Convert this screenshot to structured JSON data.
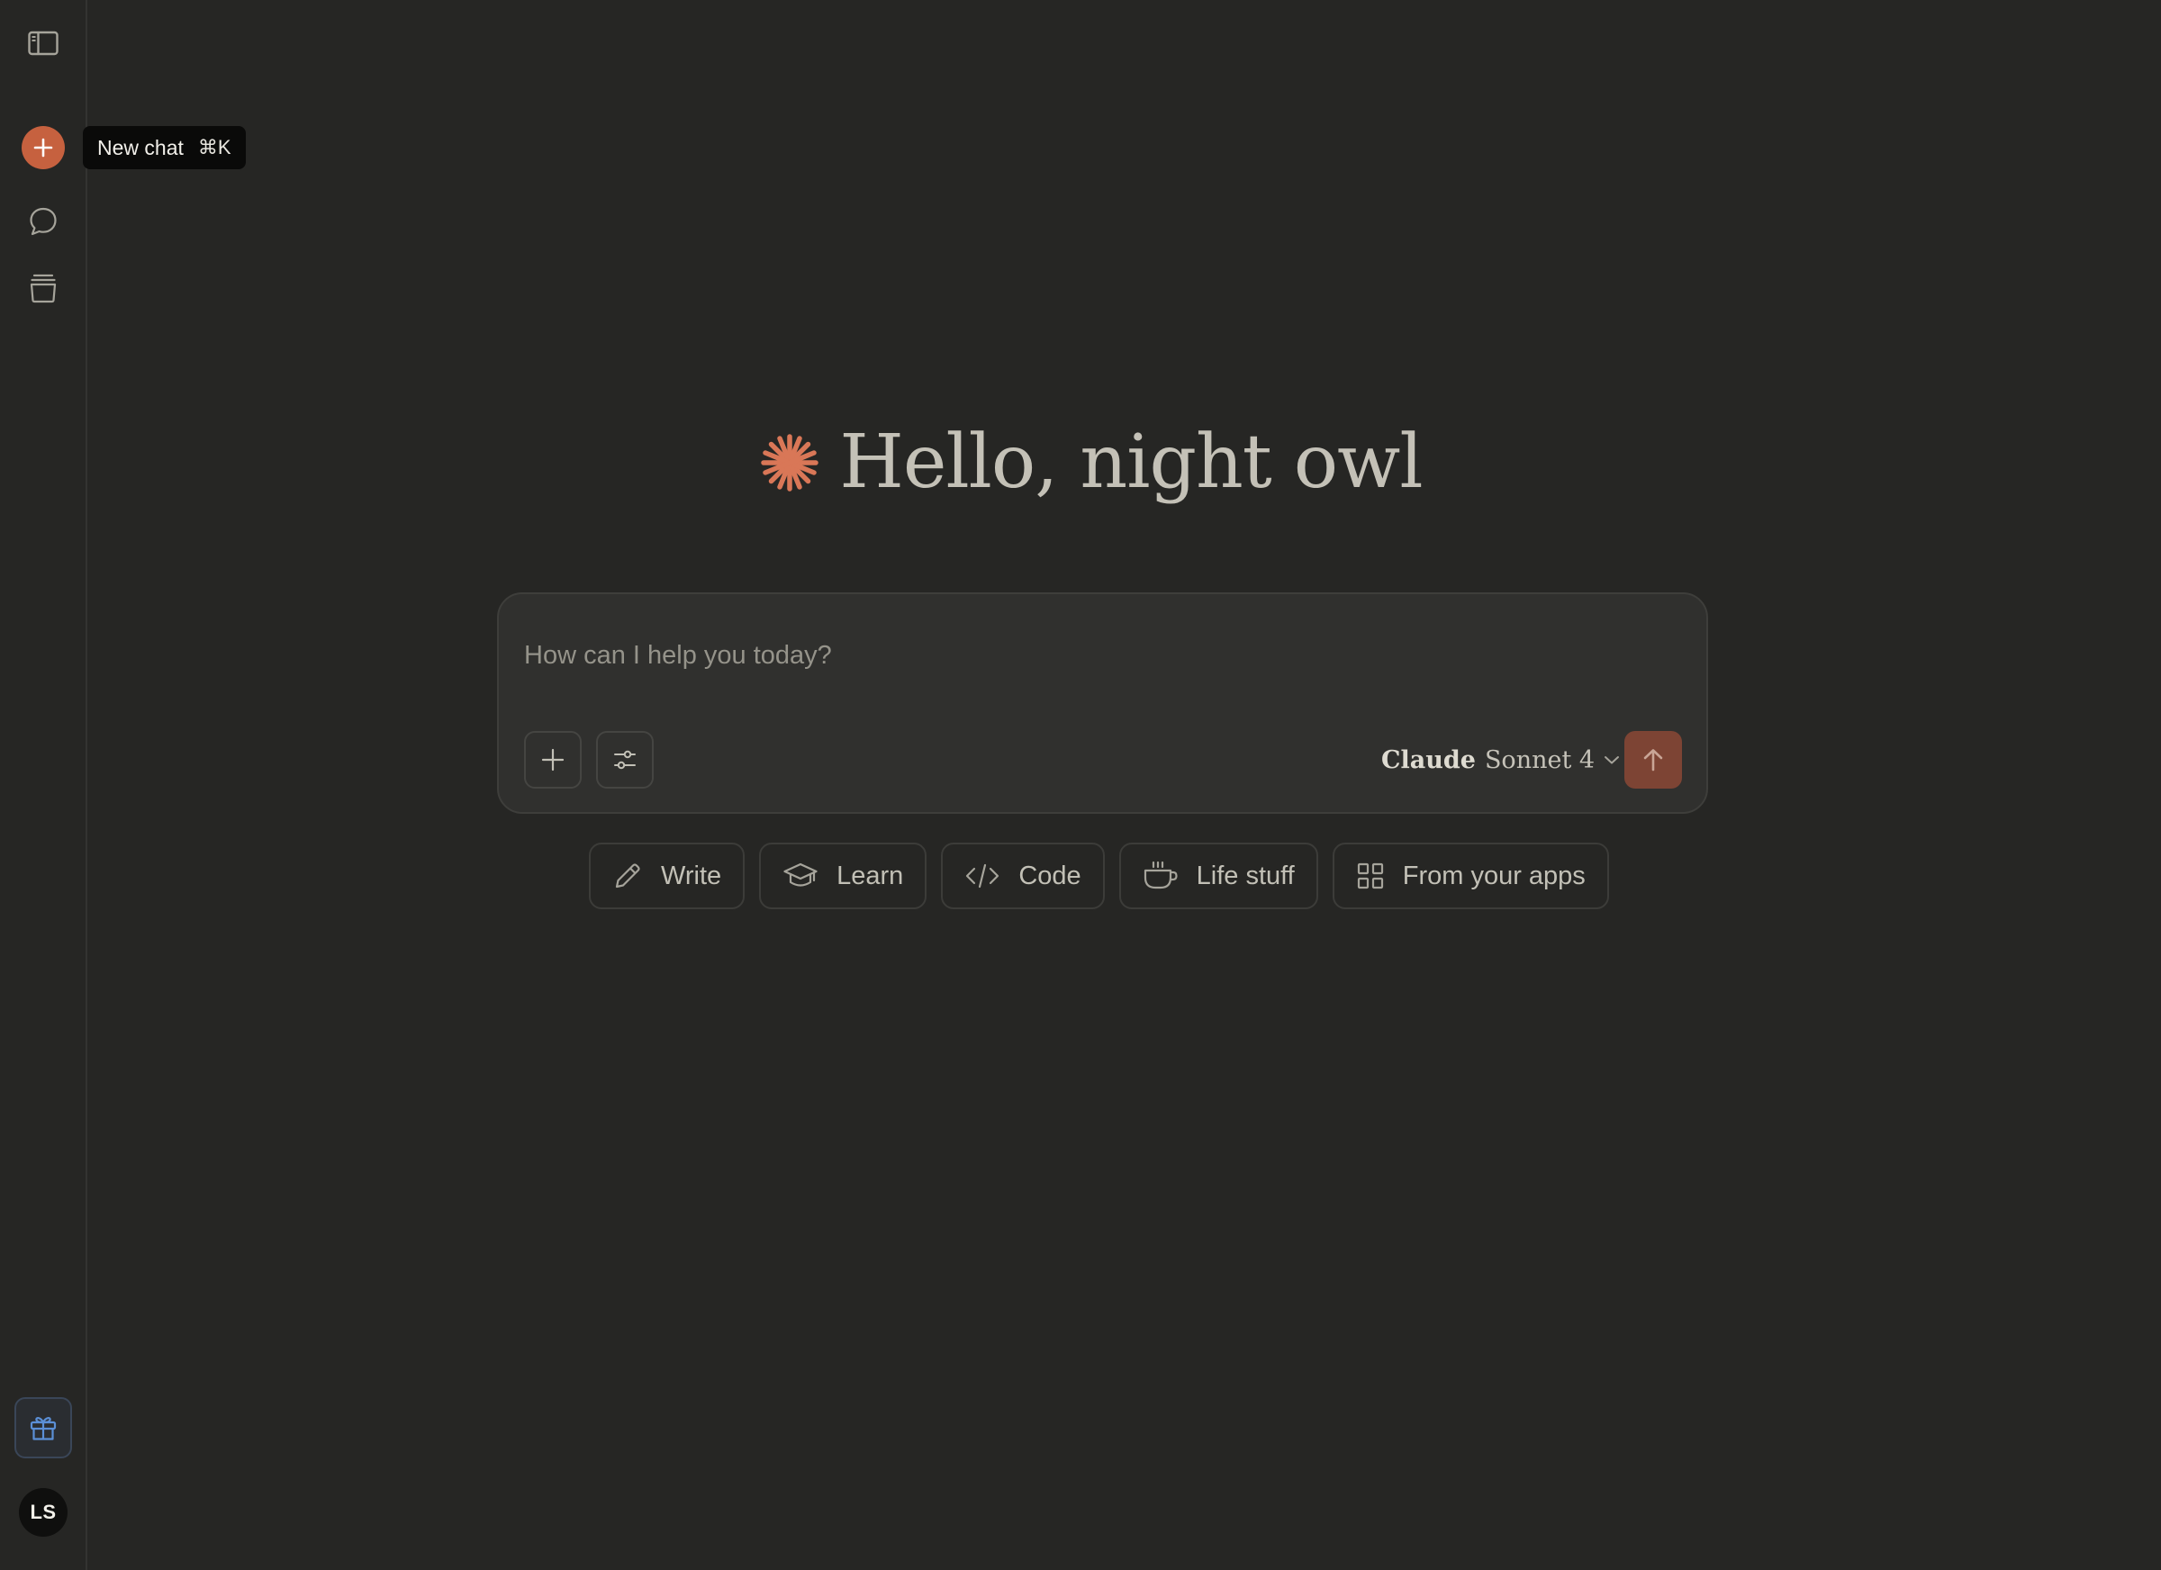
{
  "sidebar": {
    "items": [
      {
        "name": "sidebar-toggle",
        "icon": "sidebar-panel-icon"
      },
      {
        "name": "new-chat",
        "icon": "plus-icon"
      },
      {
        "name": "chats",
        "icon": "chat-bubble-icon"
      },
      {
        "name": "projects",
        "icon": "archive-box-icon"
      }
    ],
    "gift_icon": "gift-icon",
    "avatar_initials": "LS"
  },
  "tooltip": {
    "label": "New chat",
    "shortcut": "⌘K"
  },
  "greeting": {
    "text": "Hello, night owl",
    "logo": "asterisk-burst-icon"
  },
  "composer": {
    "placeholder": "How can I help you today?",
    "value": "",
    "model_brand": "Claude",
    "model_name": "Sonnet 4"
  },
  "suggestions": [
    {
      "label": "Write",
      "icon": "pencil-icon"
    },
    {
      "label": "Learn",
      "icon": "graduation-cap-icon"
    },
    {
      "label": "Code",
      "icon": "code-icon"
    },
    {
      "label": "Life stuff",
      "icon": "coffee-cup-icon"
    },
    {
      "label": "From your apps",
      "icon": "grid-icon"
    }
  ],
  "colors": {
    "background": "#262624",
    "accent": "#c6613f",
    "send_button": "#7d4434",
    "composer": "#30302e"
  }
}
